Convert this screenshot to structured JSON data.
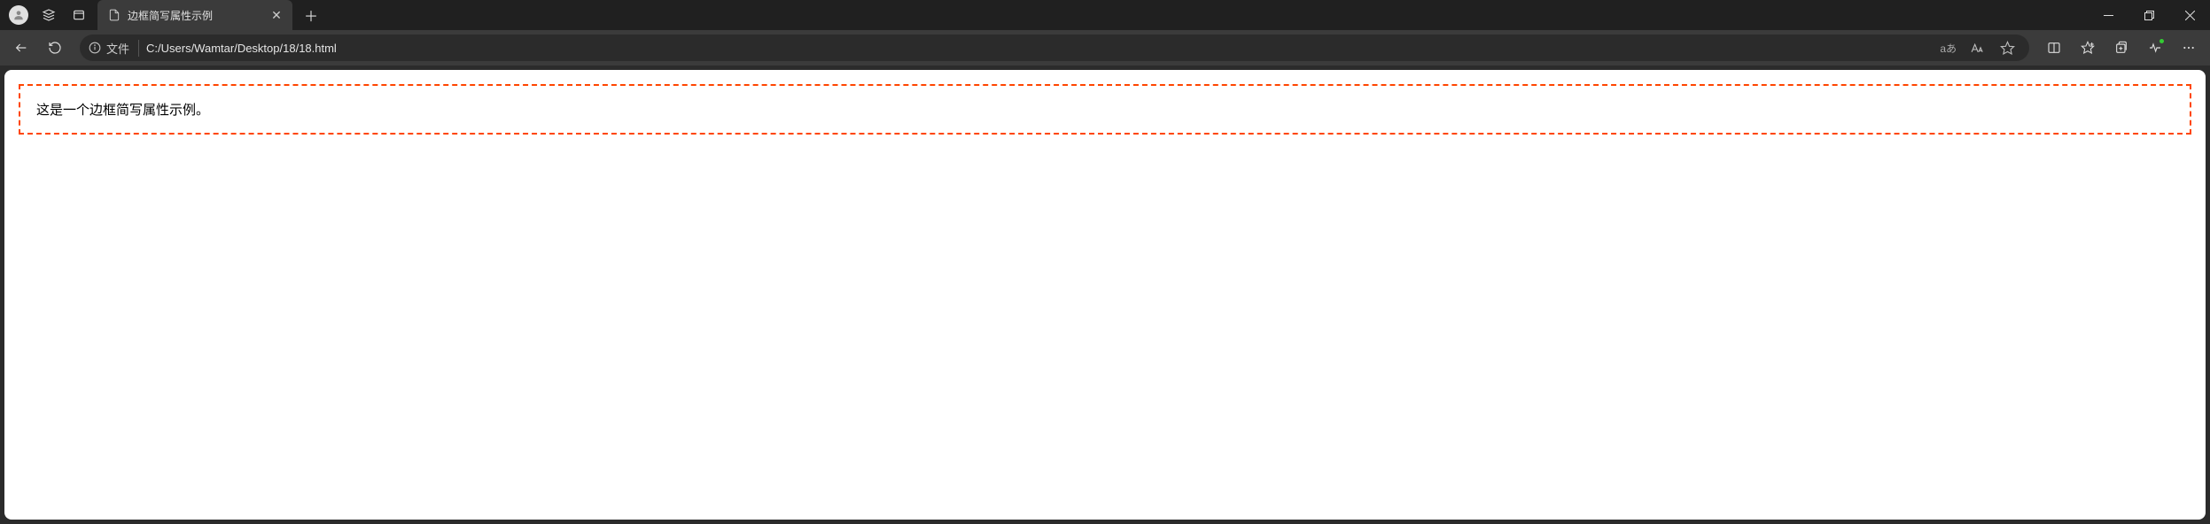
{
  "tab": {
    "title": "边框简写属性示例"
  },
  "addressbar": {
    "prefix": "文件",
    "url": "C:/Users/Wamtar/Desktop/18/18.html",
    "translate_label": "aあ"
  },
  "page": {
    "content_text": "这是一个边框简写属性示例。"
  }
}
